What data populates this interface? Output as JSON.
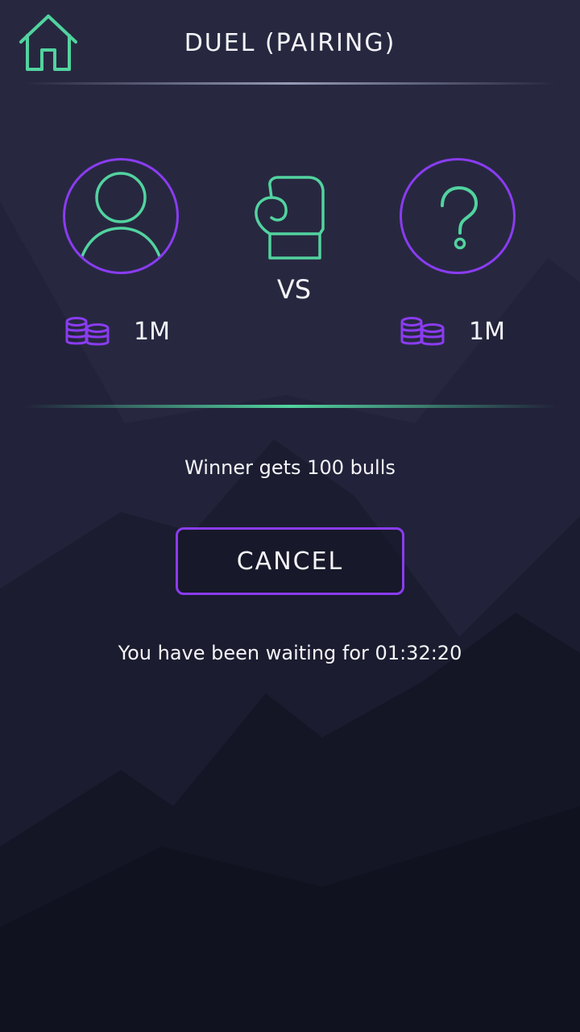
{
  "header": {
    "title": "DUEL (PAIRING)",
    "home_icon": "home-icon"
  },
  "players": {
    "left": {
      "avatar_icon": "user-icon",
      "coins_icon": "coins-icon",
      "stake": "1M"
    },
    "right": {
      "avatar_icon": "question-icon",
      "coins_icon": "coins-icon",
      "stake": "1M"
    }
  },
  "versus": {
    "icon": "boxing-glove-icon",
    "label": "VS"
  },
  "prize_text": "Winner gets 100 bulls",
  "cancel_label": "CANCEL",
  "waiting_text": "You have been waiting for 01:32:20",
  "colors": {
    "background": "#1c1d30",
    "accent_purple": "#8a3cf0",
    "accent_green": "#52d39f",
    "text": "#f4f4f8"
  }
}
